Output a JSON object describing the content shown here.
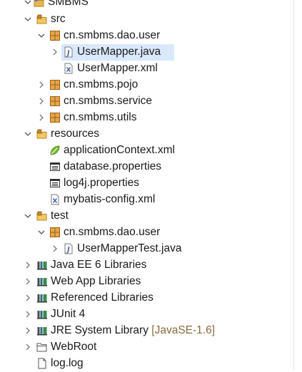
{
  "tree": {
    "project": "SMBMS",
    "src": "src",
    "pkg_dao_user": "cn.smbms.dao.user",
    "usermapper_java": "UserMapper.java",
    "usermapper_xml": "UserMapper.xml",
    "pkg_pojo": "cn.smbms.pojo",
    "pkg_service": "cn.smbms.service",
    "pkg_utils": "cn.smbms.utils",
    "resources": "resources",
    "app_context": "applicationContext.xml",
    "database_props": "database.properties",
    "log4j_props": "log4j.properties",
    "mybatis_config": "mybatis-config.xml",
    "test": "test",
    "test_pkg_dao_user": "cn.smbms.dao.user",
    "usermapper_test": "UserMapperTest.java",
    "javaee_lib": "Java EE 6 Libraries",
    "webapp_lib": "Web App Libraries",
    "referenced_lib": "Referenced Libraries",
    "junit_lib": "JUnit 4",
    "jre_lib": "JRE System Library",
    "jre_decoration": "[JavaSE-1.6]",
    "webroot": "WebRoot",
    "log_file": "log.log"
  },
  "colors": {
    "selection": "#d9e8fb",
    "package_icon": "#c8852f",
    "decoration": "#8a6a3c"
  }
}
